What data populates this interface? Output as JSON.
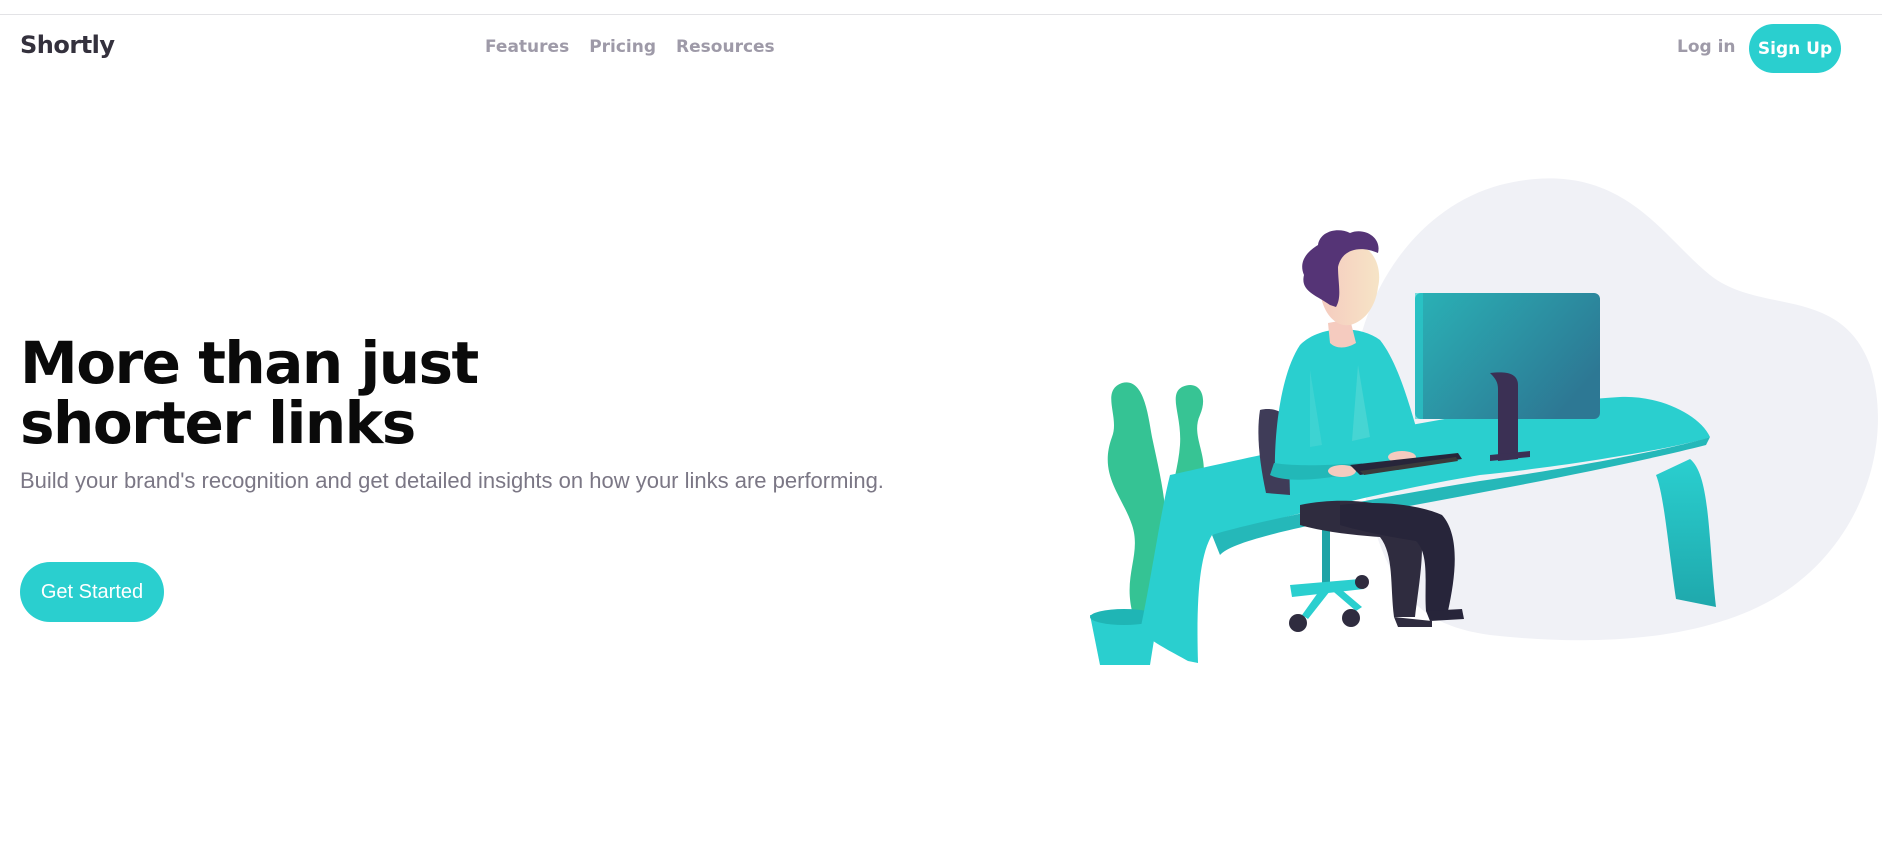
{
  "header": {
    "logo": "Shortly",
    "nav": [
      {
        "label": "Features"
      },
      {
        "label": "Pricing"
      },
      {
        "label": "Resources"
      }
    ],
    "login_label": "Log in",
    "signup_label": "Sign Up"
  },
  "hero": {
    "title_line1": "More than just",
    "title_line2": "shorter links",
    "subtitle": "Build your brand's recognition and get detailed insights on how your links are performing.",
    "cta_label": "Get Started"
  },
  "illustration": {
    "icon": "person-working-at-desk-illustration"
  },
  "colors": {
    "accent": "#2acfcf",
    "dark_violet": "#3b3054",
    "grayish_violet": "#9e9aa8",
    "very_dark": "#34313d",
    "blob": "#f0f1f6"
  }
}
